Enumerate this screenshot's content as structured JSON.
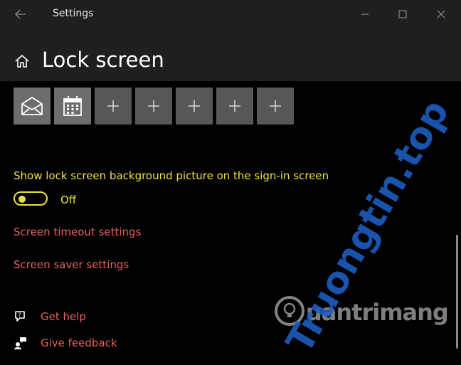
{
  "window": {
    "title": "Settings"
  },
  "header": {
    "page_title": "Lock screen"
  },
  "quick_status_tiles": [
    {
      "icon": "mail-icon"
    },
    {
      "icon": "calendar-icon"
    },
    {
      "icon": "plus-icon"
    },
    {
      "icon": "plus-icon"
    },
    {
      "icon": "plus-icon"
    },
    {
      "icon": "plus-icon"
    },
    {
      "icon": "plus-icon"
    }
  ],
  "sign_in_background": {
    "label": "Show lock screen background picture on the sign-in screen",
    "state": "Off",
    "enabled": false
  },
  "links": {
    "screen_timeout": "Screen timeout settings",
    "screen_saver": "Screen saver settings",
    "get_help": "Get help",
    "give_feedback": "Give feedback"
  },
  "colors": {
    "accent": "#e9e43d",
    "link": "#e8625a",
    "titlebar_bg": "#1f1f1f",
    "tile_bg": "#575757"
  },
  "watermark": {
    "brand": "uantrimang",
    "diagonal": "Truongtin.top"
  }
}
